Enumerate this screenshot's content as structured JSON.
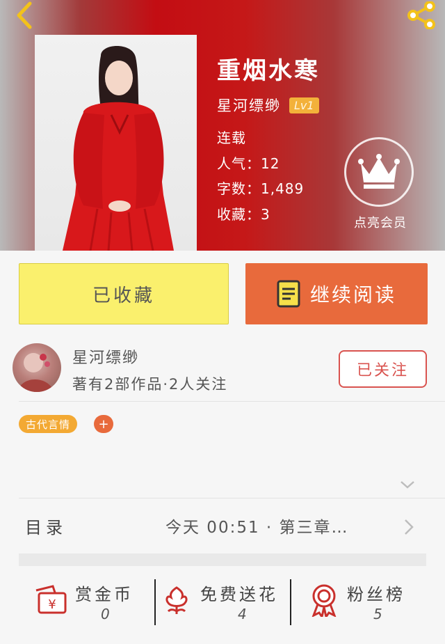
{
  "header": {
    "back_icon": "chevron-left-icon",
    "share_icon": "share-icon"
  },
  "book": {
    "title": "重烟水寒",
    "author": "星河缥缈",
    "level": "Lv1",
    "status": "连载",
    "popularity": "人气：12",
    "word_count": "字数：1,489",
    "favorites": "收藏：3",
    "vip_label": "点亮会员"
  },
  "actions": {
    "favorited_label": "已收藏",
    "continue_label": "继续阅读"
  },
  "author_card": {
    "name": "星河缥缈",
    "stats": "著有2部作品·2人关注",
    "follow_label": "已关注"
  },
  "tags": {
    "genre": "古代言情",
    "add": "+"
  },
  "toc": {
    "label": "目录",
    "latest": "今天 00:51 · 第三章…"
  },
  "stats": {
    "coins": {
      "label": "赏金币",
      "value": "0",
      "icon": "red-envelope-yen-icon"
    },
    "flowers": {
      "label": "免费送花",
      "value": "4",
      "icon": "flower-icon"
    },
    "fans": {
      "label": "粉丝榜",
      "value": "5",
      "icon": "medal-icon"
    }
  },
  "colors": {
    "hero_red": "#c30d13",
    "favorite_yellow": "#faf06d",
    "read_orange": "#e86a3c",
    "tag_orange": "#f3a933",
    "follow_red": "#d9534f"
  }
}
